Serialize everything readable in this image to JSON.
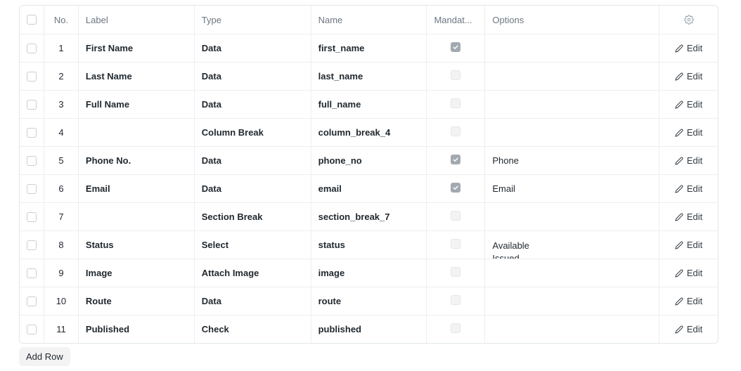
{
  "table": {
    "headers": {
      "no": "No.",
      "label": "Label",
      "type": "Type",
      "name": "Name",
      "mandatory": "Mandat...",
      "options": "Options",
      "settings_icon": "gear-icon"
    },
    "edit_label": "Edit",
    "rows": [
      {
        "no": "1",
        "label": "First Name",
        "type": "Data",
        "name": "first_name",
        "mandatory": true,
        "options": ""
      },
      {
        "no": "2",
        "label": "Last Name",
        "type": "Data",
        "name": "last_name",
        "mandatory": false,
        "options": ""
      },
      {
        "no": "3",
        "label": "Full Name",
        "type": "Data",
        "name": "full_name",
        "mandatory": false,
        "options": ""
      },
      {
        "no": "4",
        "label": "",
        "type": "Column Break",
        "name": "column_break_4",
        "mandatory": false,
        "options": ""
      },
      {
        "no": "5",
        "label": "Phone No.",
        "type": "Data",
        "name": "phone_no",
        "mandatory": true,
        "options": "Phone"
      },
      {
        "no": "6",
        "label": "Email",
        "type": "Data",
        "name": "email",
        "mandatory": true,
        "options": "Email"
      },
      {
        "no": "7",
        "label": "",
        "type": "Section Break",
        "name": "section_break_7",
        "mandatory": false,
        "options": ""
      },
      {
        "no": "8",
        "label": "Status",
        "type": "Select",
        "name": "status",
        "mandatory": false,
        "options": "Available\nIssued"
      },
      {
        "no": "9",
        "label": "Image",
        "type": "Attach Image",
        "name": "image",
        "mandatory": false,
        "options": ""
      },
      {
        "no": "10",
        "label": "Route",
        "type": "Data",
        "name": "route",
        "mandatory": false,
        "options": ""
      },
      {
        "no": "11",
        "label": "Published",
        "type": "Check",
        "name": "published",
        "mandatory": false,
        "options": ""
      }
    ]
  },
  "add_row_label": "Add Row"
}
